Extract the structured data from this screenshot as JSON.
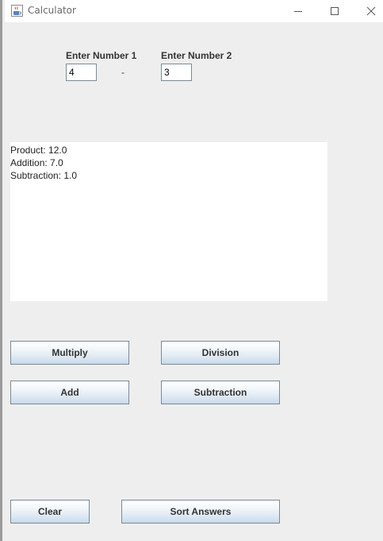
{
  "window": {
    "title": "Calculator",
    "icons": {
      "app": "java-coffee-cup-icon",
      "minimize": "minimize-icon",
      "maximize": "maximize-icon",
      "close": "close-icon"
    }
  },
  "inputs": {
    "number1_label": "Enter Number 1",
    "number1_value": "4",
    "operator": "-",
    "number2_label": "Enter Number 2",
    "number2_value": "3"
  },
  "results": {
    "lines": [
      "Product: 12.0",
      "Addition: 7.0",
      "Subtraction: 1.0"
    ]
  },
  "buttons": {
    "multiply": "Multiply",
    "division": "Division",
    "add": "Add",
    "subtraction": "Subtraction",
    "clear": "Clear",
    "sort_answers": "Sort Answers"
  }
}
